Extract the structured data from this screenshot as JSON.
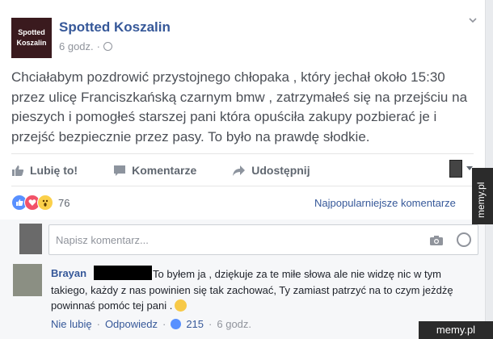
{
  "post": {
    "page_avatar_line1": "Spotted",
    "page_avatar_line2": "Koszalin",
    "page_name": "Spotted Koszalin",
    "time": "6 godz.",
    "separator": "·",
    "text": "Chciałabym pozdrowić przystojnego chłopaka , który jechał około 15:30 przez ulicę Franciszkańską czarnym bmw , zatrzymałeś się na przejściu na pieszych i pomogłeś starszej pani która opuściła zakupy pozbierać je i przejść bezpiecznie przez pasy. To było na prawdę słodkie."
  },
  "actions": {
    "like": "Lubię to!",
    "comment": "Komentarze",
    "share": "Udostępnij"
  },
  "reactions": {
    "count": "76",
    "top_comments": "Najpopularniejsze komentarze"
  },
  "comment_box": {
    "placeholder": "Napisz komentarz..."
  },
  "comment": {
    "author": "Brayan",
    "text": "To byłem ja , dziękuje za te miłe słowa ale nie widzę nic w tym takiego, każdy z nas powinien się tak zachować, Ty zamiast patrzyć na to czym jeżdżę powinnaś pomóc tej pani .",
    "unlike": "Nie lubię",
    "reply": "Odpowiedz",
    "dot": "·",
    "likes": "215",
    "time": "6 godz."
  },
  "watermark": {
    "side": "memy.pl",
    "bottom": "memy.pl"
  },
  "colors": {
    "link": "#365899",
    "background": "#e9ebee",
    "like_blue": "#5890ff",
    "love_red": "#f25268",
    "wow_yellow": "#fbd04a"
  }
}
